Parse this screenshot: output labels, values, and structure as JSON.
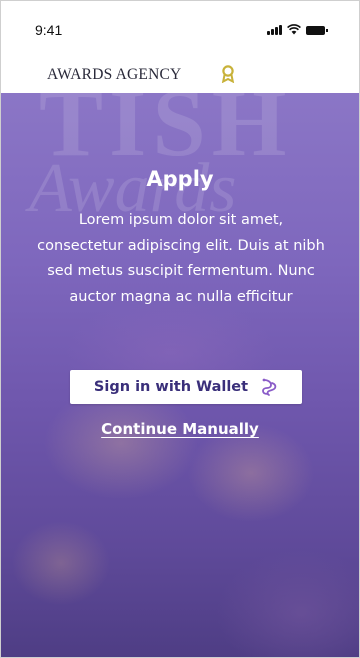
{
  "status_bar": {
    "time": "9:41",
    "icons": [
      "signal-icon",
      "wifi-icon",
      "battery-icon"
    ]
  },
  "header": {
    "brand": "AWARDS AGENCY",
    "brand_icon": "award-icon",
    "brand_icon_color": "#c8b23a"
  },
  "hero": {
    "background_color": "#7e67bd",
    "title": "Apply",
    "description": "Lorem ipsum dolor sit amet, consectetur adipiscing elit. Duis at nibh sed metus suscipit fermentum. Nunc auctor magna ac nulla efficitur"
  },
  "actions": {
    "wallet_button_label": "Sign in with Wallet",
    "wallet_icon": "wallet-link-icon",
    "continue_label": "Continue Manually"
  },
  "colors": {
    "accent": "#3a2f7a",
    "wallet_icon_color": "#8a5cc8"
  }
}
